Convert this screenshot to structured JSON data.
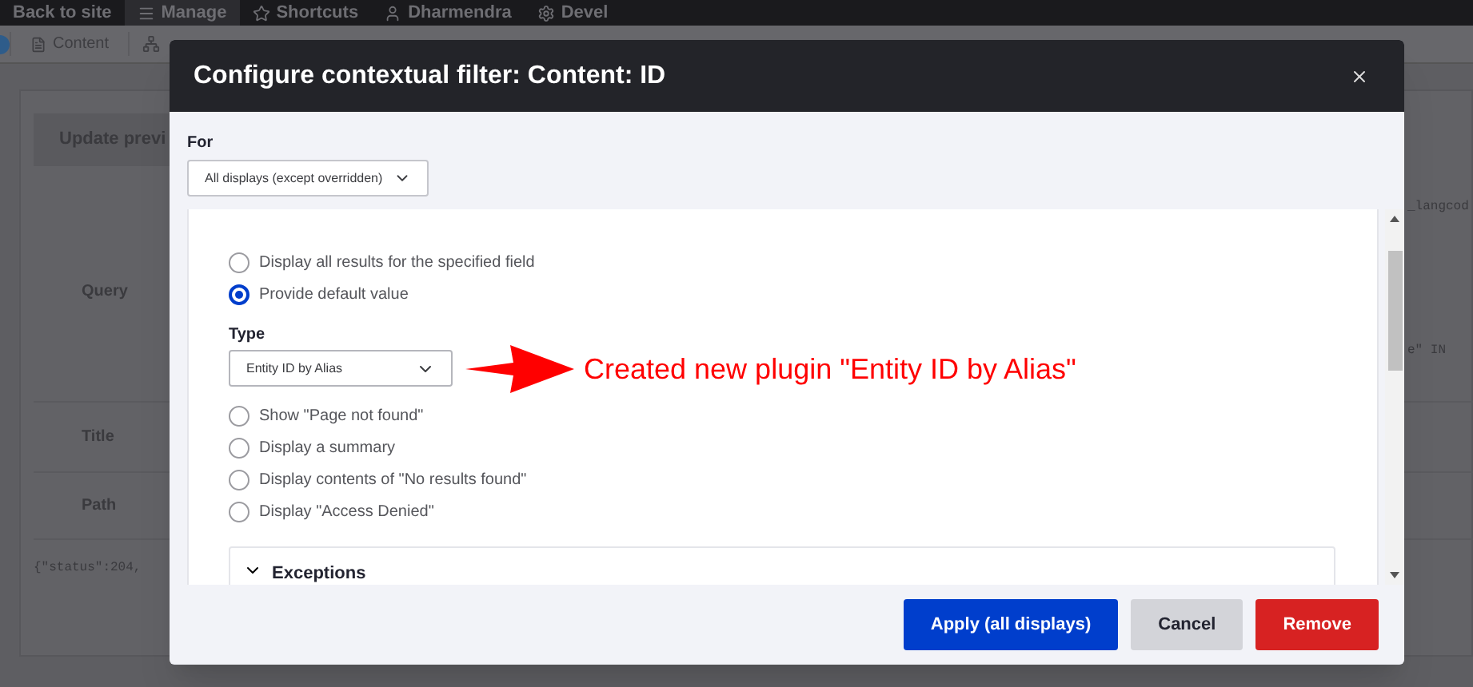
{
  "toolbar": {
    "items": [
      "Back to site",
      "Manage",
      "Shortcuts",
      "Dharmendra",
      "Devel"
    ]
  },
  "admin_menu": {
    "items": [
      "Content"
    ]
  },
  "preview": {
    "button": "Update previ",
    "rows": [
      {
        "label": "Query",
        "right_lines": [
          "_langcod",
          "e\" IN"
        ]
      },
      {
        "label": "Title"
      },
      {
        "label": "Path"
      }
    ],
    "response": "{\"status\":204,"
  },
  "dialog": {
    "title": "Configure contextual filter: Content: ID",
    "for": {
      "label": "For",
      "value": "All displays (except overridden)"
    },
    "options": [
      {
        "label": "Display all results for the specified field",
        "selected": false
      },
      {
        "label": "Provide default value",
        "selected": true
      },
      {
        "label": "Show \"Page not found\"",
        "selected": false
      },
      {
        "label": "Display a summary",
        "selected": false
      },
      {
        "label": "Display contents of \"No results found\"",
        "selected": false
      },
      {
        "label": "Display \"Access Denied\"",
        "selected": false
      }
    ],
    "type": {
      "label": "Type",
      "value": "Entity ID by Alias"
    },
    "exceptions": {
      "label": "Exceptions"
    },
    "buttons": [
      {
        "label": "Apply (all displays)",
        "kind": "primary"
      },
      {
        "label": "Cancel",
        "kind": "secondary"
      },
      {
        "label": "Remove",
        "kind": "danger"
      }
    ]
  },
  "annotation": {
    "text": "Created new plugin \"Entity ID by Alias\""
  }
}
